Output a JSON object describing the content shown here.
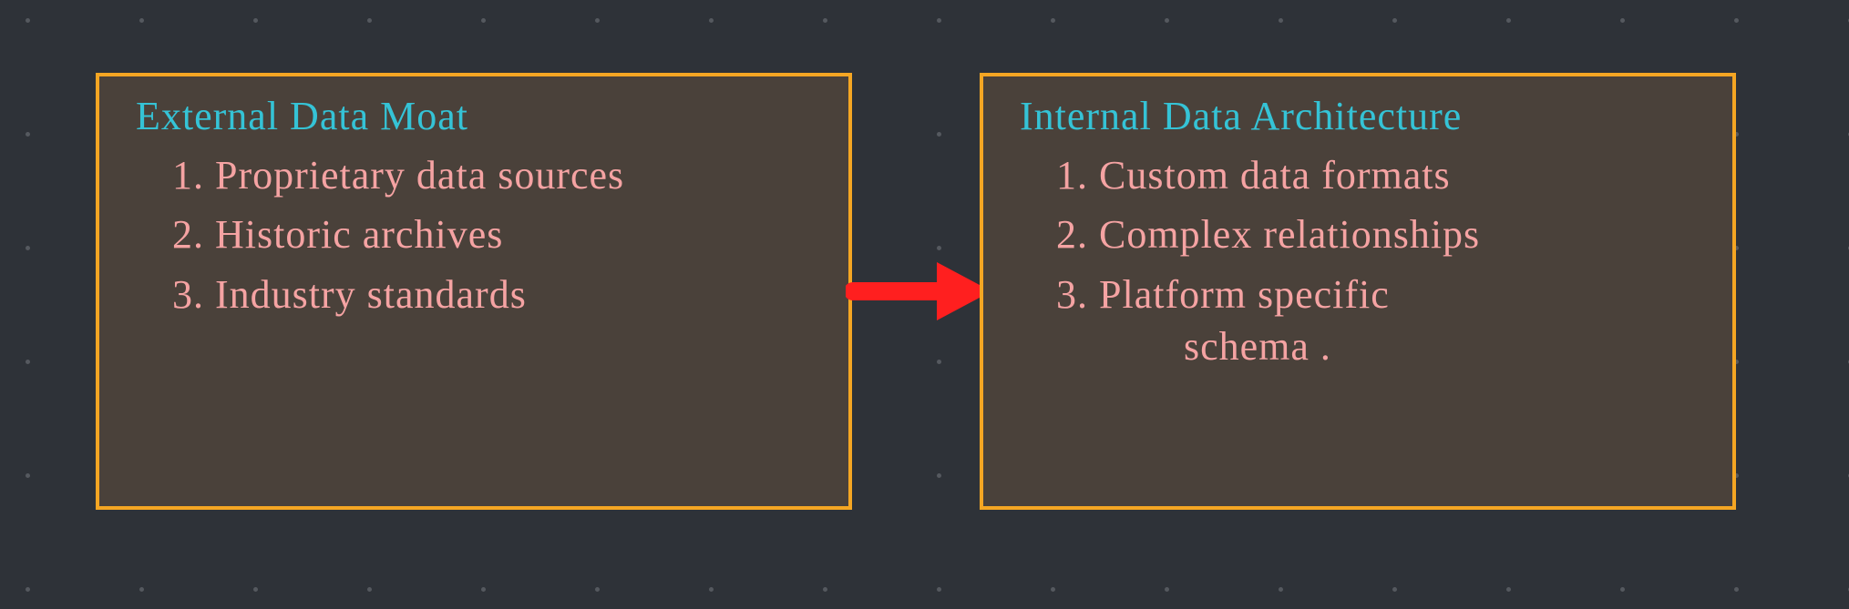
{
  "left_box": {
    "title": "External Data  Moat",
    "items": [
      "1. Proprietary data sources",
      "2. Historic archives",
      "3. Industry standards"
    ]
  },
  "right_box": {
    "title": "Internal Data Architecture",
    "items": [
      "1. Custom data formats",
      "2. Complex relationships",
      "3. Platform specific"
    ],
    "item3_continue": "schema ."
  },
  "colors": {
    "background": "#2e3238",
    "box_border": "#f5a623",
    "box_fill": "#4a413a",
    "title": "#35c3d6",
    "item": "#f5a3a3",
    "arrow": "#ff1f1f",
    "dot": "#55595f"
  }
}
